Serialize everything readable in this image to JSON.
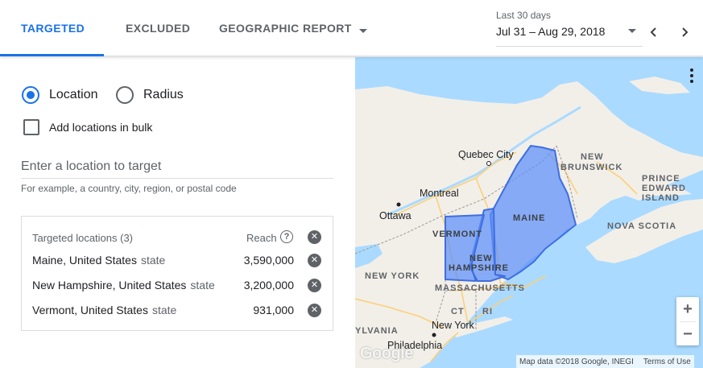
{
  "tabs": [
    {
      "label": "TARGETED"
    },
    {
      "label": "EXCLUDED"
    },
    {
      "label": "GEOGRAPHIC REPORT"
    }
  ],
  "date": {
    "label": "Last 30 days",
    "range": "Jul 31 – Aug 29, 2018"
  },
  "options": {
    "location_label": "Location",
    "radius_label": "Radius",
    "bulk_label": "Add locations in bulk"
  },
  "search": {
    "placeholder": "Enter a location to target",
    "hint": "For example, a country, city, region, or postal code"
  },
  "targeted": {
    "title": "Targeted locations (3)",
    "reach_header": "Reach",
    "rows": [
      {
        "name": "Maine, United States",
        "type": "state",
        "reach": "3,590,000"
      },
      {
        "name": "New Hampshire, United States",
        "type": "state",
        "reach": "3,200,000"
      },
      {
        "name": "Vermont, United States",
        "type": "state",
        "reach": "931,000"
      }
    ]
  },
  "map": {
    "labels": {
      "quebec_city": "Quebec City",
      "new_brunswick_1": "NEW",
      "new_brunswick_2": "BRUNSWICK",
      "pei_1": "PRINCE",
      "pei_2": "EDWARD",
      "pei_3": "ISLAND",
      "montreal": "Montreal",
      "ottawa": "Ottawa",
      "maine": "MAINE",
      "nova_scotia": "NOVA SCOTIA",
      "vermont": "VERMONT",
      "nh_1": "NEW",
      "nh_2": "HAMPSHIRE",
      "new_york_state": "NEW YORK",
      "massachusetts": "MASSACHUSETTS",
      "ct": "CT",
      "ri": "RI",
      "new_york_city": "New York",
      "pennsylvania": "YLVANIA",
      "philadelphia": "Philadelphia"
    },
    "attribution": "Map data ©2018 Google, INEGI",
    "terms": "Terms of Use",
    "logo": "Google",
    "colors": {
      "water": "#aadaff",
      "land": "#f2efe9",
      "region": "#5b8ff9"
    }
  }
}
